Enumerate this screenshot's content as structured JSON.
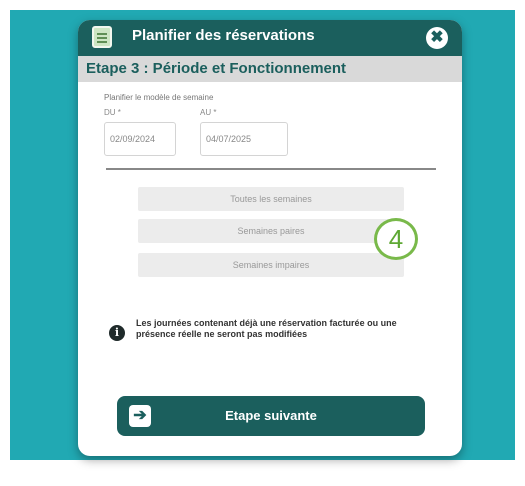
{
  "modal": {
    "title": "Planifier des réservations",
    "close_glyph": "✖",
    "step_title": "Etape 3 : Période et Fonctionnement"
  },
  "form": {
    "plan_label": "Planifier le modèle de semaine",
    "from_label": "DU *",
    "to_label": "AU *",
    "from_value": "02/09/2024",
    "to_value": "04/07/2025"
  },
  "options": {
    "all_weeks": "Toutes les semaines",
    "even_weeks": "Semaines paires",
    "odd_weeks": "Semaines impaires"
  },
  "badge": {
    "number": "4"
  },
  "info": {
    "icon_glyph": "i",
    "text": "Les journées contenant déjà une réservation facturée ou une présence réelle ne seront pas modifiées"
  },
  "footer": {
    "next_label": "Etape suivante",
    "next_glyph": "➔"
  },
  "colors": {
    "background": "#21a9b3",
    "header": "#1b5f5d",
    "step_bar": "#d9d9d9",
    "badge": "#79b94a"
  },
  "icons": [
    "calendar-icon",
    "close-icon",
    "info-icon",
    "arrow-right-icon"
  ]
}
